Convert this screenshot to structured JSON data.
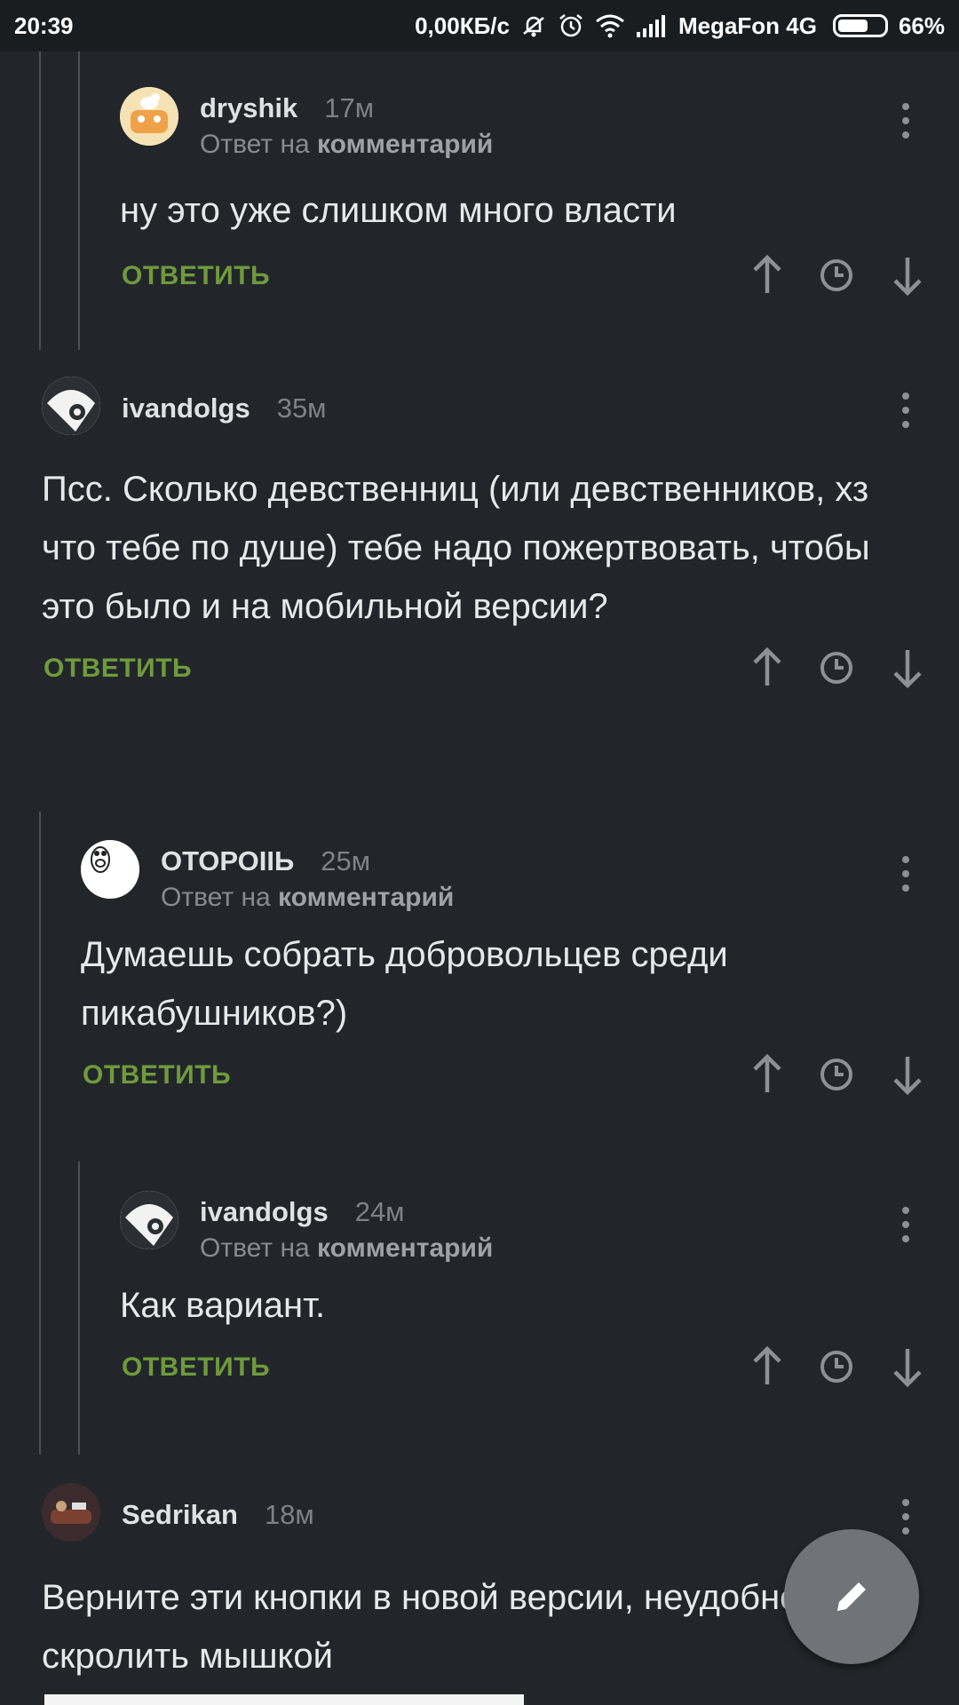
{
  "status_bar": {
    "time": "20:39",
    "speed": "0,00КБ/с",
    "carrier": "MegaFon 4G",
    "battery": "66%",
    "battery_level": 0.66,
    "icons": [
      "mute-icon",
      "alarm-icon",
      "wifi-icon",
      "signal-icon",
      "battery-icon"
    ]
  },
  "comments": [
    {
      "author": "dryshik",
      "time": "17м",
      "reply_prefix": "Ответ на",
      "reply_target": "комментарий",
      "text": "ну это уже слишком много власти",
      "reply_label": "ОТВЕТИТЬ"
    },
    {
      "author": "ivandolgs",
      "time": "35м",
      "text": "Псс. Сколько девственниц (или девственников, хз что тебе по душе) тебе надо пожертвовать, чтобы это было и на мобильной версии?",
      "reply_label": "ОТВЕТИТЬ"
    },
    {
      "author": "ОТОРОІІЬ",
      "time": "25м",
      "reply_prefix": "Ответ на",
      "reply_target": "комментарий",
      "text": "Думаешь собрать добровольцев среди пикабушников?)",
      "reply_label": "ОТВЕТИТЬ"
    },
    {
      "author": "ivandolgs",
      "time": "24м",
      "reply_prefix": "Ответ на",
      "reply_target": "комментарий",
      "text": "Как вариант.",
      "reply_label": "ОТВЕТИТЬ"
    },
    {
      "author": "Sedrikan",
      "time": "18м",
      "text": "Верните эти кнопки в новой версии, неудобно скролить мышкой"
    }
  ],
  "colors": {
    "background": "#22262a",
    "accent_green": "#6f9a3c",
    "fab": "#707478"
  },
  "fab_icon": "pencil-icon"
}
